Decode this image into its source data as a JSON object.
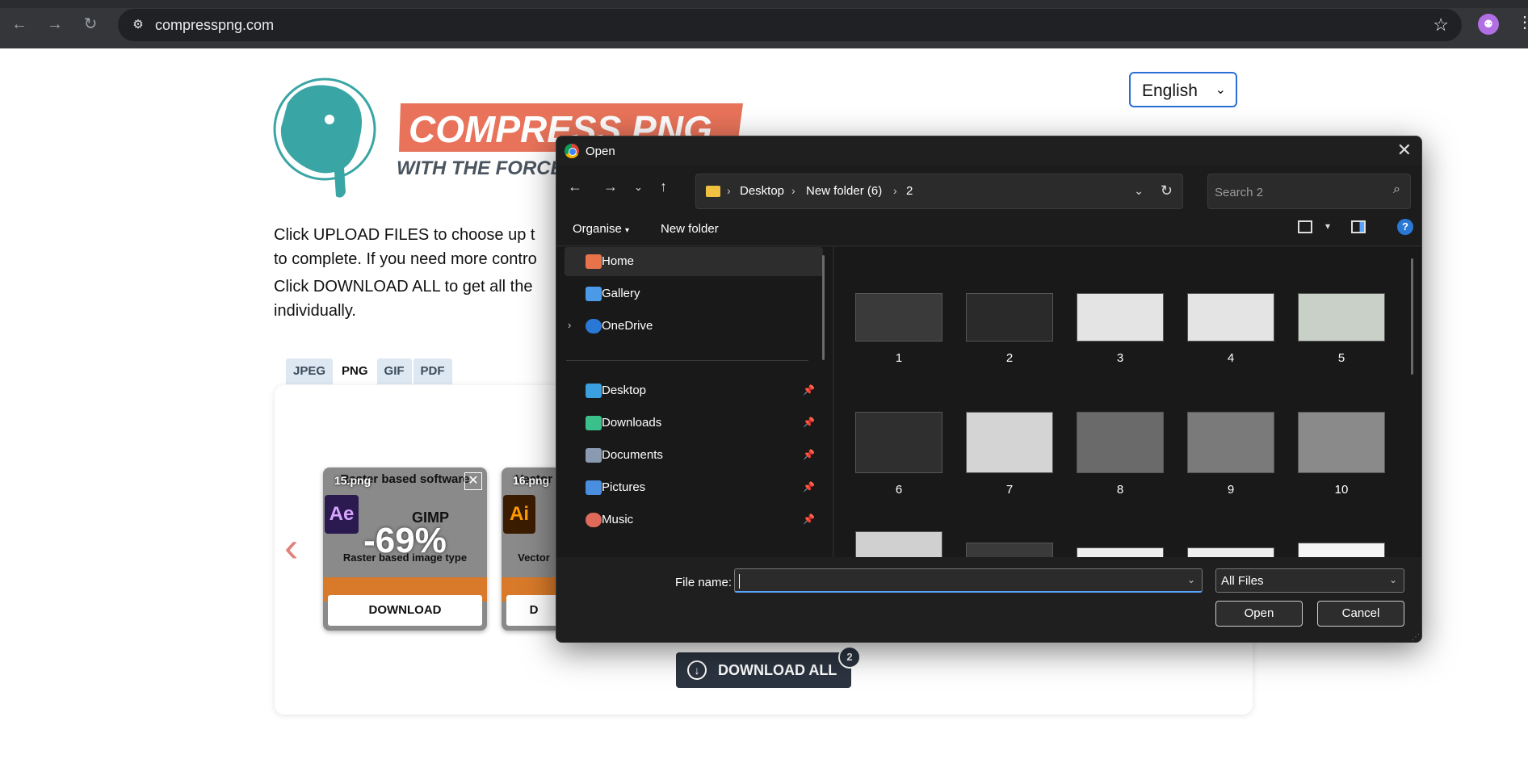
{
  "browser": {
    "url": "compresspng.com"
  },
  "page": {
    "logo_title": "COMPRESS PNG",
    "logo_subtitle": "WITH THE FORCE",
    "language": "English",
    "intro_line1a": "Click UPLOAD FILES to choose up t",
    "intro_line1b": "to complete. If you need more contro",
    "intro_line2a": "Click DOWNLOAD ALL to get all the",
    "intro_line2b": "individually.",
    "tabs": [
      "JPEG",
      "PNG",
      "GIF",
      "PDF"
    ],
    "active_tab": "PNG",
    "thumbs": [
      {
        "filename": "15.png",
        "inner_title": "Raster based software",
        "percent": "-69%",
        "badge": "Ae",
        "software_label": "GIMP",
        "caption": "Raster based image type",
        "download_label": "DOWNLOAD"
      },
      {
        "filename": "16.png",
        "inner_title": "Vector",
        "badge": "Ai",
        "caption": "Vector",
        "download_label": "D"
      }
    ],
    "download_all_label": "DOWNLOAD ALL",
    "download_all_count": "2"
  },
  "dialog": {
    "title": "Open",
    "breadcrumb": [
      "Desktop",
      "New folder (6)",
      "2"
    ],
    "search_placeholder": "Search 2",
    "organise_label": "Organise",
    "new_folder_label": "New folder",
    "sidebar": [
      {
        "label": "Home",
        "icon": "home-icon",
        "color": "#e8734a"
      },
      {
        "label": "Gallery",
        "icon": "gallery-icon",
        "color": "#4a9ae8"
      },
      {
        "label": "OneDrive",
        "icon": "cloud-icon",
        "color": "#2a78d6"
      },
      {
        "label": "Desktop",
        "icon": "desktop-icon",
        "color": "#3aa0e0"
      },
      {
        "label": "Downloads",
        "icon": "download-icon",
        "color": "#3ac08a"
      },
      {
        "label": "Documents",
        "icon": "document-icon",
        "color": "#8a9ab0"
      },
      {
        "label": "Pictures",
        "icon": "pictures-icon",
        "color": "#4a8ee0"
      },
      {
        "label": "Music",
        "icon": "music-icon",
        "color": "#e06a5a"
      }
    ],
    "files": [
      "1",
      "2",
      "3",
      "4",
      "5",
      "6",
      "7",
      "8",
      "9",
      "10"
    ],
    "file_name_label": "File name:",
    "file_name_value": "",
    "file_type": "All Files",
    "open_label": "Open",
    "cancel_label": "Cancel"
  }
}
